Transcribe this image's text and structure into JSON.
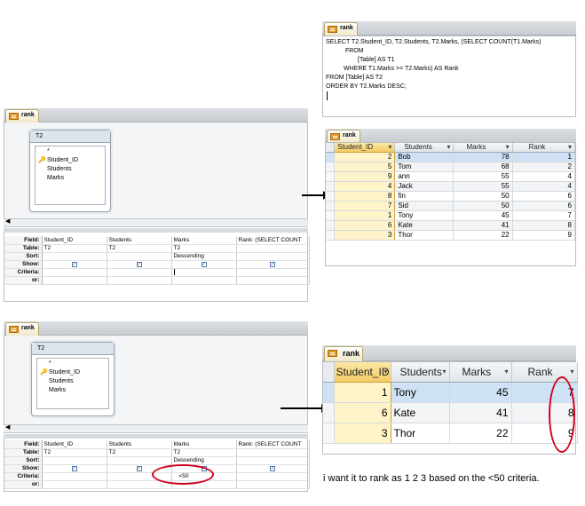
{
  "sql": {
    "tab": "rank",
    "lines": [
      "SELECT T2.Student_ID, T2.Students, T2.Marks, (SELECT COUNT(T1.Marks)",
      "FROM",
      "[Table] AS T1",
      "WHERE T1.Marks >= T2.Marks) AS Rank",
      "FROM [Table] AS T2",
      "ORDER BY T2.Marks DESC;"
    ]
  },
  "design1": {
    "tab": "rank",
    "table_name": "T2",
    "fields": [
      "*",
      "Student_ID",
      "Students",
      "Marks"
    ],
    "row_labels": [
      "Field:",
      "Table:",
      "Sort:",
      "Show:",
      "Criteria:",
      "or:"
    ],
    "columns": [
      {
        "field": "Student_ID",
        "table": "T2",
        "sort": "",
        "criteria": ""
      },
      {
        "field": "Students",
        "table": "T2",
        "sort": "",
        "criteria": ""
      },
      {
        "field": "Marks",
        "table": "T2",
        "sort": "Descending",
        "criteria": ""
      },
      {
        "field": "Rank: (SELECT COUNT",
        "table": "",
        "sort": "",
        "criteria": ""
      }
    ]
  },
  "design2": {
    "tab": "rank",
    "table_name": "T2",
    "fields": [
      "*",
      "Student_ID",
      "Students",
      "Marks"
    ],
    "row_labels": [
      "Field:",
      "Table:",
      "Sort:",
      "Show:",
      "Criteria:",
      "or:"
    ],
    "columns": [
      {
        "field": "Student_ID",
        "table": "T2",
        "sort": "",
        "criteria": ""
      },
      {
        "field": "Students",
        "table": "T2",
        "sort": "",
        "criteria": ""
      },
      {
        "field": "Marks",
        "table": "T2",
        "sort": "Descending",
        "criteria": "<50"
      },
      {
        "field": "Rank: (SELECT COUNT",
        "table": "",
        "sort": "",
        "criteria": ""
      }
    ]
  },
  "result1": {
    "tab": "rank",
    "headers": [
      "Student_ID",
      "Students",
      "Marks",
      "Rank"
    ],
    "rows": [
      [
        "2",
        "Bob",
        "78",
        "1"
      ],
      [
        "5",
        "Tom",
        "68",
        "2"
      ],
      [
        "9",
        "ann",
        "55",
        "4"
      ],
      [
        "4",
        "Jack",
        "55",
        "4"
      ],
      [
        "8",
        "fin",
        "50",
        "6"
      ],
      [
        "7",
        "Sid",
        "50",
        "6"
      ],
      [
        "1",
        "Tony",
        "45",
        "7"
      ],
      [
        "6",
        "Kate",
        "41",
        "8"
      ],
      [
        "3",
        "Thor",
        "22",
        "9"
      ]
    ]
  },
  "result2": {
    "tab": "rank",
    "headers": [
      "Student_ID",
      "Students",
      "Marks",
      "Rank"
    ],
    "rows": [
      [
        "1",
        "Tony",
        "45",
        "7"
      ],
      [
        "6",
        "Kate",
        "41",
        "8"
      ],
      [
        "3",
        "Thor",
        "22",
        "9"
      ]
    ]
  },
  "note": "i want it to rank as 1 2 3 based on the <50 criteria.",
  "colors": {
    "highlight_row": "#cfe2f5",
    "selected_header": "#f4cc64",
    "annotation": "#d0021b"
  }
}
